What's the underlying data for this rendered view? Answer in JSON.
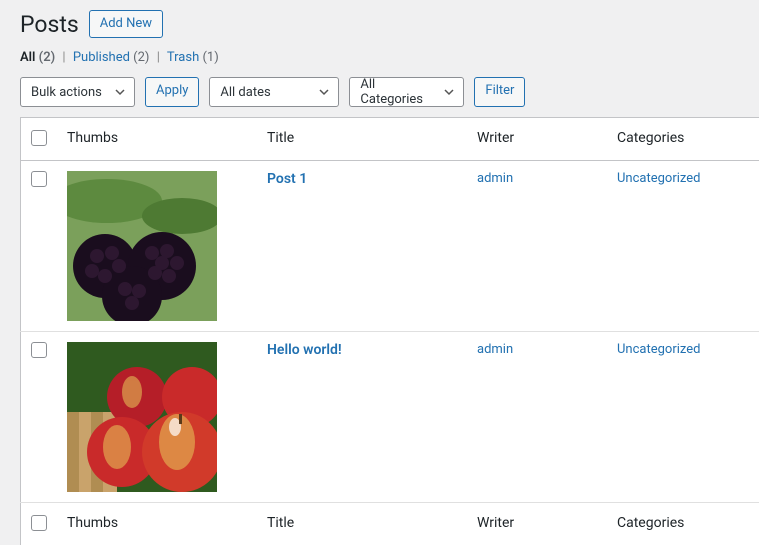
{
  "header": {
    "title": "Posts",
    "add_new": "Add New"
  },
  "filters": {
    "all_label": "All",
    "all_count": "(2)",
    "published_label": "Published",
    "published_count": "(2)",
    "trash_label": "Trash",
    "trash_count": "(1)"
  },
  "actions": {
    "bulk": "Bulk actions",
    "apply": "Apply",
    "dates": "All dates",
    "categories": "All Categories",
    "filter": "Filter"
  },
  "columns": {
    "thumbs": "Thumbs",
    "title": "Title",
    "writer": "Writer",
    "categories": "Categories"
  },
  "rows": [
    {
      "title": "Post 1",
      "writer": "admin",
      "categories": "Uncategorized",
      "thumb": "blackberries"
    },
    {
      "title": "Hello world!",
      "writer": "admin",
      "categories": "Uncategorized",
      "thumb": "apples"
    }
  ],
  "colors": {
    "link": "#2271b1"
  }
}
